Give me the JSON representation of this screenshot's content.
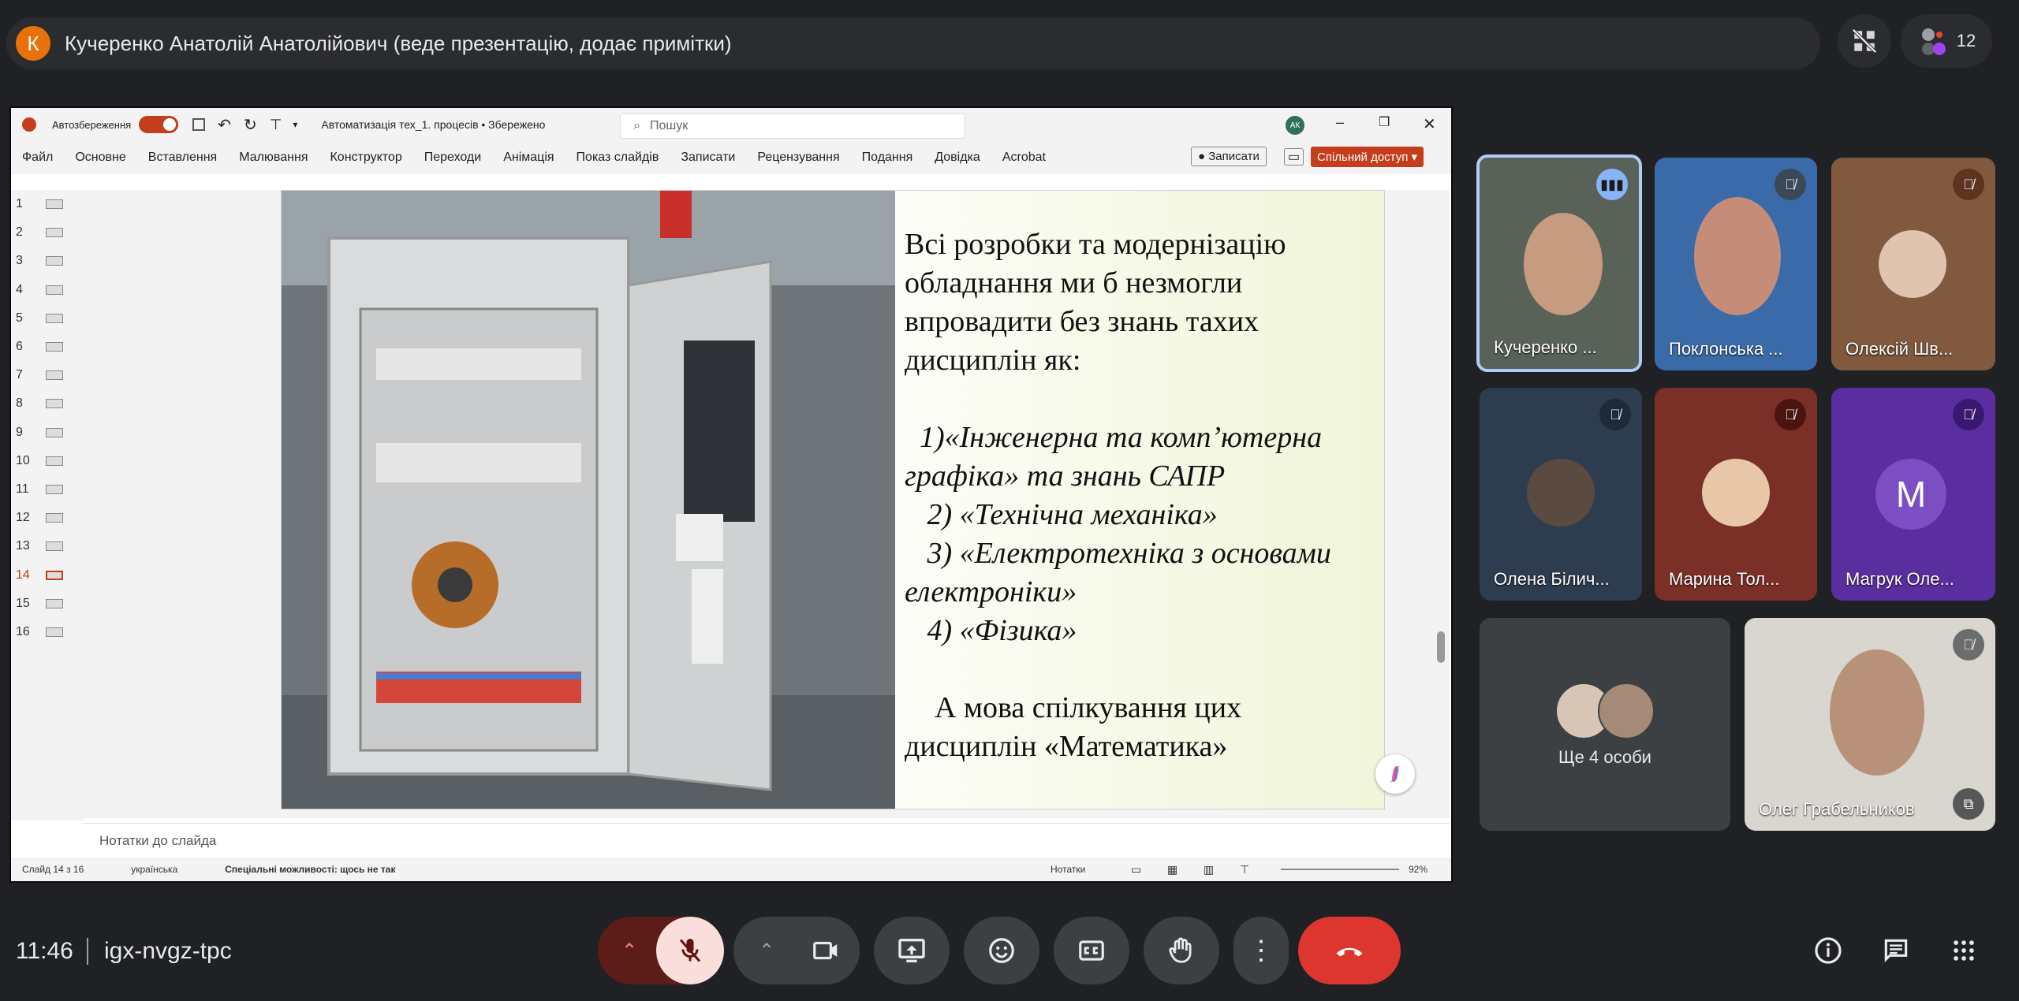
{
  "top_bar": {
    "presenter_initial": "К",
    "presenter_text": "Кучеренко Анатолій Анатолійович (веде презентацію, додає примітки)",
    "participants_count": "12"
  },
  "powerpoint": {
    "autosave_label": "Автозбереження",
    "file_title": "Автоматизація тех_1. процесів • Збережено",
    "search_placeholder": "Пошук",
    "user_initials": "АК",
    "menu": [
      "Файл",
      "Основне",
      "Вставлення",
      "Малювання",
      "Конструктор",
      "Переходи",
      "Анімація",
      "Показ слайдів",
      "Записати",
      "Рецензування",
      "Подання",
      "Довідка",
      "Acrobat"
    ],
    "record_button": "Записати",
    "share_button": "Спільний доступ",
    "slide_numbers": [
      "1",
      "2",
      "3",
      "4",
      "5",
      "6",
      "7",
      "8",
      "9",
      "10",
      "11",
      "12",
      "13",
      "14",
      "15",
      "16"
    ],
    "active_slide": "14",
    "notes_placeholder": "Нотатки до слайда",
    "status": {
      "slide_of": "Слайд 14 з 16",
      "language": "українська",
      "accessibility": "Спеціальні можливості: щось не так",
      "notes": "Нотатки",
      "zoom": "92%"
    }
  },
  "slide": {
    "lines": [
      "Всі розробки та модернізацію",
      "обладнання ми б незмогли",
      "впровадити без знань тахих",
      "дисциплін як:",
      "",
      "  1)«Інженерна та комп’ютерна",
      "графіка» та знань САПР",
      "   2) «Технічна механіка»",
      "   3) «Електротехніка з основами",
      "електроніки»",
      "   4) «Фізика»",
      "",
      "    А мова спілкування цих",
      "дисциплін «Математика»"
    ]
  },
  "participants": [
    {
      "name": "Кучеренко ..."
    },
    {
      "name": "Поклонська ..."
    },
    {
      "name": "Олексій Шв..."
    },
    {
      "name": "Олена Білич..."
    },
    {
      "name": "Марина Тол..."
    },
    {
      "name": "Магрук Оле...",
      "initial": "М"
    },
    {
      "name": "Ще 4 особи"
    },
    {
      "name": "Олег Грабельников"
    }
  ],
  "bottom": {
    "time": "11:46",
    "meeting_code": "igx-nvgz-tpc"
  },
  "colors": {
    "accent_red": "#ea4335",
    "end_call_red": "#dc362e",
    "ppt_orange": "#c43e1c"
  }
}
